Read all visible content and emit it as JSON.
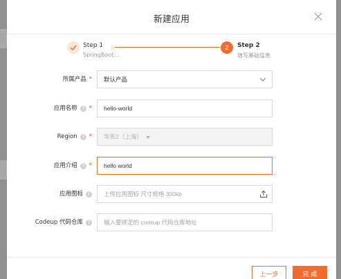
{
  "modal": {
    "title": "新建应用"
  },
  "steps": [
    {
      "title": "Step 1",
      "subtitle": "SpringBoot…",
      "state": "done"
    },
    {
      "number": "2",
      "title": "Step 2",
      "subtitle": "填写基础信息",
      "state": "active"
    }
  ],
  "form": {
    "product": {
      "label": "所属产品",
      "required_mark": "*",
      "value": "默认产品"
    },
    "app_name": {
      "label": "应用名称",
      "required_mark": "*",
      "value": "hello-world"
    },
    "region": {
      "label": "Region",
      "required_mark": "*",
      "value": "华东2（上海）"
    },
    "description": {
      "label": "应用介绍",
      "required_mark": "*",
      "value": "hello world"
    },
    "app_icon": {
      "label": "应用图标",
      "placeholder": "上传应用图标 尺寸规格 300kb"
    },
    "codeup": {
      "label": "Codeup 代码仓库",
      "placeholder": "输入要绑定的 codeup 代码仓库地址"
    }
  },
  "footer": {
    "prev_label": "上一步",
    "done_label": "完 成"
  },
  "colors": {
    "accent": "#f26d2d",
    "required": "#e8483a"
  }
}
